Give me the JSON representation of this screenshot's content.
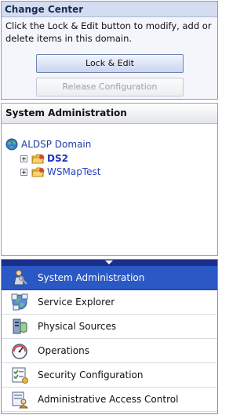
{
  "change_center": {
    "title": "Change Center",
    "description": "Click the Lock & Edit button to modify, add or delete items in this domain.",
    "lock_edit_label": "Lock & Edit",
    "release_label": "Release Configuration"
  },
  "system_admin": {
    "title": "System Administration",
    "tree": {
      "root_label": "ALDSP Domain",
      "children": [
        {
          "label": "DS2"
        },
        {
          "label": "WSMapTest"
        }
      ]
    }
  },
  "navigator": {
    "items": [
      {
        "label": "System Administration",
        "icon": "system-administration-icon"
      },
      {
        "label": "Service Explorer",
        "icon": "service-explorer-icon"
      },
      {
        "label": "Physical Sources",
        "icon": "physical-sources-icon"
      },
      {
        "label": "Operations",
        "icon": "operations-gauge-icon"
      },
      {
        "label": "Security Configuration",
        "icon": "security-configuration-icon"
      },
      {
        "label": "Administrative Access Control",
        "icon": "access-control-icon"
      }
    ],
    "selected_index": 0
  }
}
